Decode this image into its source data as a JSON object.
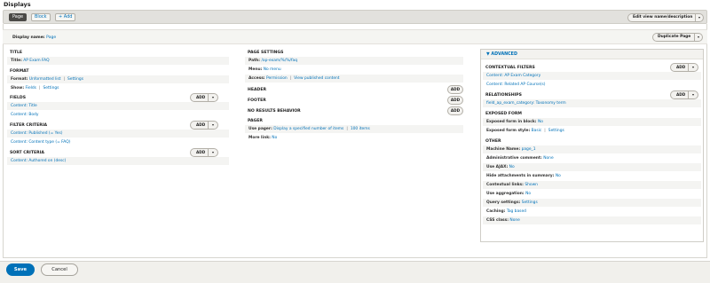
{
  "page": {
    "title": "Displays"
  },
  "tabs": [
    {
      "label": "Page"
    },
    {
      "label": "Block"
    },
    {
      "label": "+ Add"
    }
  ],
  "top_actions": {
    "edit_view_label": "Edit view name/description",
    "duplicate_label": "Duplicate Page"
  },
  "display_name": {
    "label": "Display name:",
    "value": "Page"
  },
  "left": {
    "title": {
      "heading": "TITLE",
      "label": "Title:",
      "value": "AP Exam FAQ"
    },
    "format": {
      "heading": "FORMAT",
      "format_label": "Format:",
      "format_value": "Unformatted list",
      "format_settings": "Settings",
      "show_label": "Show:",
      "show_value": "Fields",
      "show_settings": "Settings"
    },
    "fields": {
      "heading": "FIELDS",
      "add": "Add",
      "items": [
        "Content: Title",
        "Content: Body"
      ]
    },
    "filter": {
      "heading": "FILTER CRITERIA",
      "add": "Add",
      "items": [
        "Content: Published (= Yes)",
        "Content: Content type (= FAQ)"
      ]
    },
    "sort": {
      "heading": "SORT CRITERIA",
      "add": "Add",
      "items": [
        "Content: Authored on (desc)"
      ]
    }
  },
  "middle": {
    "page_settings": {
      "heading": "PAGE SETTINGS",
      "path_label": "Path:",
      "path_value": "/ap-exam/%/%/faq",
      "menu_label": "Menu:",
      "menu_value": "No menu",
      "access_label": "Access:",
      "access_value": "Permission",
      "access_extra": "View published content"
    },
    "header": {
      "heading": "HEADER",
      "add": "Add"
    },
    "footer": {
      "heading": "FOOTER",
      "add": "Add"
    },
    "no_results": {
      "heading": "NO RESULTS BEHAVIOR",
      "add": "Add"
    },
    "pager": {
      "heading": "PAGER",
      "use_label": "Use pager:",
      "use_value": "Display a specified number of items",
      "use_extra": "100 items",
      "more_label": "More link:",
      "more_value": "No"
    }
  },
  "advanced": {
    "toggle": "▼ ADVANCED",
    "contextual": {
      "heading": "CONTEXTUAL FILTERS",
      "add": "Add",
      "items": [
        "Content: AP Exam Category",
        "Content: Related AP Course(s)"
      ]
    },
    "relationships": {
      "heading": "RELATIONSHIPS",
      "add": "Add",
      "items": [
        "field_ap_exam_category: Taxonomy term"
      ]
    },
    "exposed": {
      "heading": "EXPOSED FORM",
      "block_label": "Exposed form in block:",
      "block_value": "No",
      "style_label": "Exposed form style:",
      "style_value": "Basic",
      "style_settings": "Settings"
    },
    "other": {
      "heading": "OTHER",
      "rows": [
        {
          "label": "Machine Name:",
          "value": "page_1"
        },
        {
          "label": "Administrative comment:",
          "value": "None"
        },
        {
          "label": "Use AJAX:",
          "value": "No"
        },
        {
          "label": "Hide attachments in summary:",
          "value": "No"
        },
        {
          "label": "Contextual links:",
          "value": "Shown"
        },
        {
          "label": "Use aggregation:",
          "value": "No"
        },
        {
          "label": "Query settings:",
          "value": "Settings"
        },
        {
          "label": "Caching:",
          "value": "Tag based"
        },
        {
          "label": "CSS class:",
          "value": "None"
        }
      ]
    }
  },
  "footer": {
    "save": "Save",
    "cancel": "Cancel"
  },
  "colors": {
    "link": "#0071b8",
    "primary": "#0071b8",
    "active_tab": "#4b4a47"
  }
}
